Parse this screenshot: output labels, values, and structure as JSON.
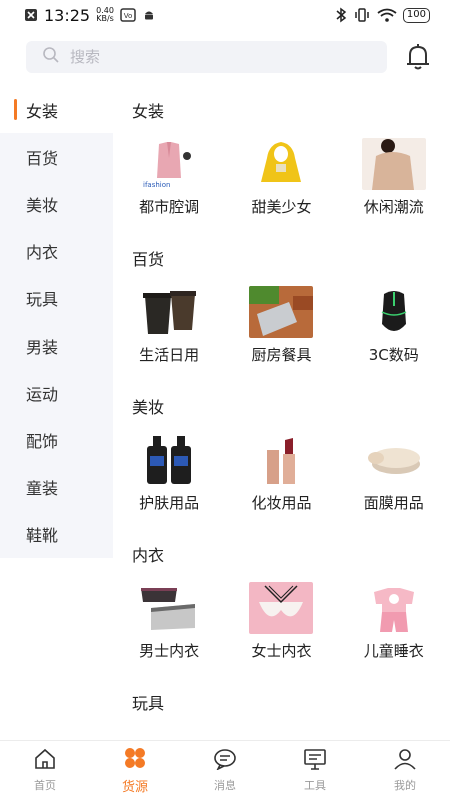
{
  "status_bar": {
    "time": "13:25",
    "speed_value": "0.40",
    "speed_unit": "KB/s",
    "battery": "100"
  },
  "search": {
    "placeholder": "搜索"
  },
  "sidebar": {
    "items": [
      {
        "label": "女装",
        "active": true
      },
      {
        "label": "百货"
      },
      {
        "label": "美妆"
      },
      {
        "label": "内衣"
      },
      {
        "label": "玩具"
      },
      {
        "label": "男装"
      },
      {
        "label": "运动"
      },
      {
        "label": "配饰"
      },
      {
        "label": "童装"
      },
      {
        "label": "鞋靴"
      }
    ]
  },
  "sections": [
    {
      "title": "女装",
      "items": [
        {
          "label": "都市腔调",
          "icon": "pink-coat-image"
        },
        {
          "label": "甜美少女",
          "icon": "yellow-hoodie-image"
        },
        {
          "label": "休闲潮流",
          "icon": "beige-sweater-image"
        }
      ]
    },
    {
      "title": "百货",
      "items": [
        {
          "label": "生活日用",
          "icon": "trash-bins-image"
        },
        {
          "label": "厨房餐具",
          "icon": "kitchen-knife-image"
        },
        {
          "label": "3C数码",
          "icon": "gaming-mouse-image"
        }
      ]
    },
    {
      "title": "美妆",
      "items": [
        {
          "label": "护肤用品",
          "icon": "skincare-bottles-image"
        },
        {
          "label": "化妆用品",
          "icon": "lipstick-image"
        },
        {
          "label": "面膜用品",
          "icon": "cream-jar-image"
        }
      ]
    },
    {
      "title": "内衣",
      "items": [
        {
          "label": "男士内衣",
          "icon": "mens-underwear-image"
        },
        {
          "label": "女士内衣",
          "icon": "bra-image"
        },
        {
          "label": "儿童睡衣",
          "icon": "kids-pajamas-image"
        }
      ]
    },
    {
      "title": "玩具",
      "items": []
    }
  ],
  "thumb_brand_text": "ifashion",
  "bottom_nav": [
    {
      "label": "首页",
      "icon": "home-icon"
    },
    {
      "label": "货源",
      "icon": "grid-flower-icon",
      "active": true
    },
    {
      "label": "消息",
      "icon": "message-icon"
    },
    {
      "label": "工具",
      "icon": "tools-icon"
    },
    {
      "label": "我的",
      "icon": "profile-icon"
    }
  ],
  "colors": {
    "accent": "#f47a25",
    "sidebar_bg": "#f5f6fa"
  }
}
